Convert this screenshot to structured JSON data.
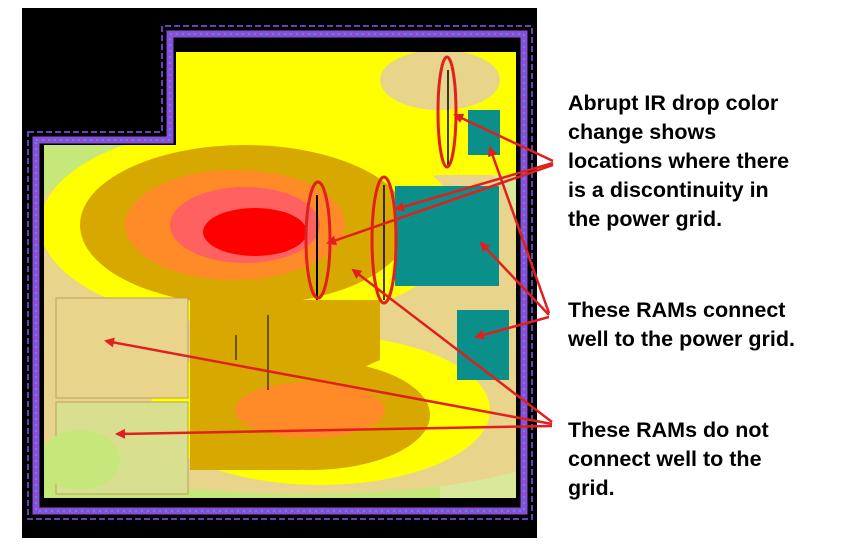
{
  "annotations": {
    "grid_discontinuity": "Abrupt IR drop color\nchange shows\nlocations where there\nis a discontinuity in\nthe power grid.",
    "rams_connect_well": "These RAMs connect\nwell to the power grid.",
    "rams_not_connected": "These RAMs do not\nconnect well to the\ngrid."
  },
  "colors": {
    "arrow": "#e02020",
    "die_background": "#000000",
    "io_ring": "#8a4fd6",
    "ir_drop_lowest": "#c6e87a",
    "ir_drop_low": "#e8d48a",
    "ir_drop_medium_low": "#ffff00",
    "ir_drop_medium": "#d6a800",
    "ir_drop_high": "#ff8a28",
    "ir_drop_very_high": "#ff6060",
    "ir_drop_highest": "#ff0000",
    "ram_macro_good": "#0a8f8a"
  }
}
